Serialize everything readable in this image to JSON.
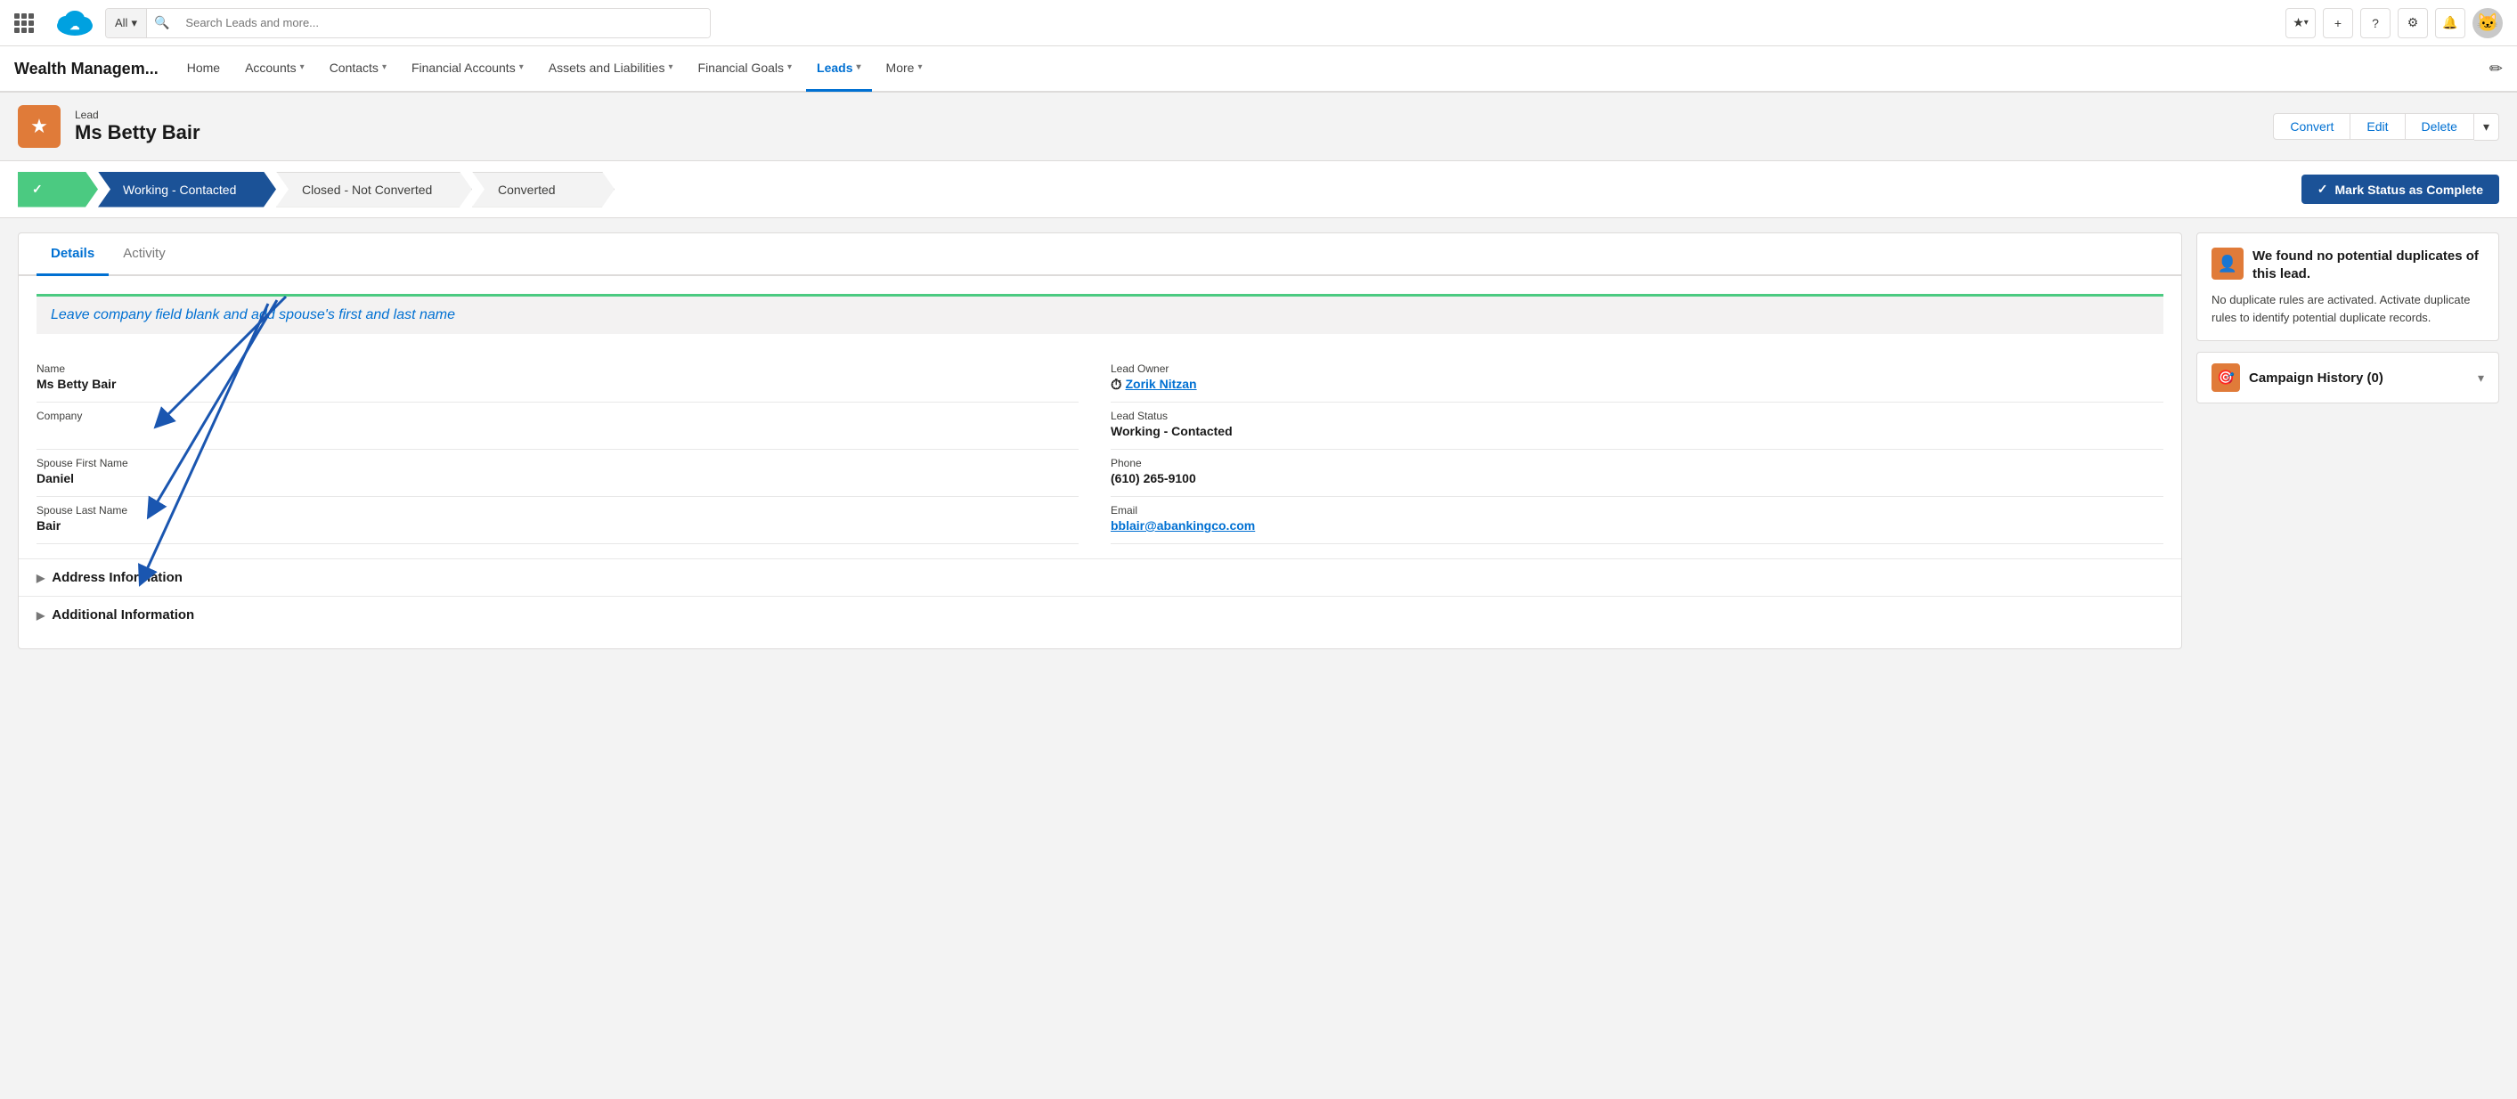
{
  "topbar": {
    "search_placeholder": "Search Leads and more...",
    "search_all_label": "All",
    "search_dropdown_icon": "▾"
  },
  "navbar": {
    "app_name": "Wealth Managem...",
    "items": [
      {
        "label": "Home",
        "has_dropdown": false,
        "active": false
      },
      {
        "label": "Accounts",
        "has_dropdown": true,
        "active": false
      },
      {
        "label": "Contacts",
        "has_dropdown": true,
        "active": false
      },
      {
        "label": "Financial Accounts",
        "has_dropdown": true,
        "active": false
      },
      {
        "label": "Assets and Liabilities",
        "has_dropdown": true,
        "active": false
      },
      {
        "label": "Financial Goals",
        "has_dropdown": true,
        "active": false
      },
      {
        "label": "Leads",
        "has_dropdown": true,
        "active": true
      },
      {
        "label": "More",
        "has_dropdown": true,
        "active": false
      }
    ]
  },
  "record_header": {
    "type_label": "Lead",
    "record_name": "Ms Betty Bair",
    "icon": "★",
    "actions": {
      "convert": "Convert",
      "edit": "Edit",
      "delete": "Delete"
    }
  },
  "path": {
    "steps": [
      {
        "label": "",
        "state": "completed",
        "show_check": true
      },
      {
        "label": "Working - Contacted",
        "state": "active",
        "show_check": false
      },
      {
        "label": "Closed - Not Converted",
        "state": "inactive",
        "show_check": false
      },
      {
        "label": "Converted",
        "state": "inactive",
        "show_check": false
      }
    ],
    "mark_btn_label": "Mark Status as Complete",
    "mark_btn_check": "✓"
  },
  "tabs": [
    {
      "label": "Details",
      "active": true
    },
    {
      "label": "Activity",
      "active": false
    }
  ],
  "annotation": {
    "text": "Leave company field blank and add spouse's first and last name"
  },
  "fields_left": [
    {
      "label": "Name",
      "value": "Ms Betty Bair",
      "empty": false
    },
    {
      "label": "Company",
      "value": "",
      "empty": true
    },
    {
      "label": "Spouse First Name",
      "value": "Daniel",
      "empty": false
    },
    {
      "label": "Spouse Last Name",
      "value": "Bair",
      "empty": false
    }
  ],
  "fields_right": [
    {
      "label": "Lead Owner",
      "value": "Zorik Nitzan",
      "empty": false,
      "is_link": true
    },
    {
      "label": "Lead Status",
      "value": "Working - Contacted",
      "empty": false,
      "is_link": false
    },
    {
      "label": "Phone",
      "value": "(610) 265-9100",
      "empty": false,
      "is_link": false
    },
    {
      "label": "Email",
      "value": "bblair@abankingco.com",
      "empty": false,
      "is_link": true
    }
  ],
  "address_section": {
    "label": "Address Information"
  },
  "right_panel": {
    "duplicate_card": {
      "icon": "👤",
      "title": "We found no potential duplicates of this lead.",
      "body": "No duplicate rules are activated. Activate duplicate rules to identify potential duplicate records."
    },
    "campaign_card": {
      "icon": "🎯",
      "title": "Campaign History (0)"
    }
  }
}
